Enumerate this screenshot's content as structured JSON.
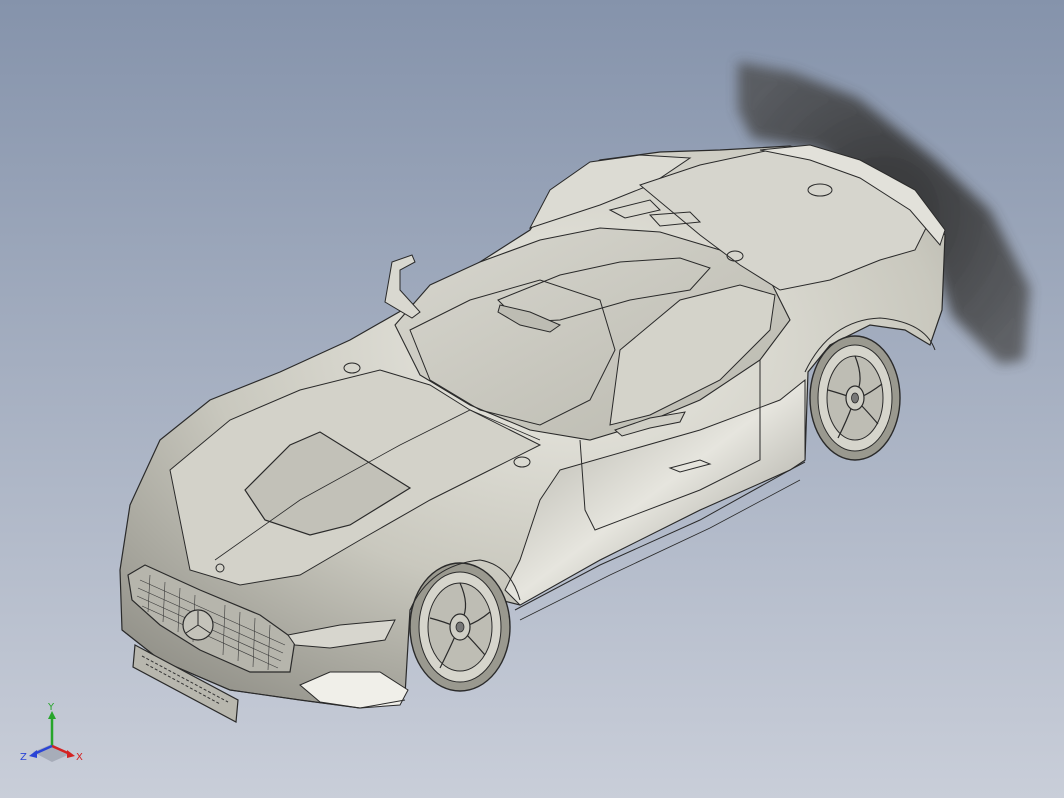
{
  "viewport": {
    "model": "car-body-3d",
    "background_top": "#8593ab",
    "background_bottom": "#c9ced9",
    "model_color": "#c8c7bd",
    "edge_color": "#2a2a2a"
  },
  "triad": {
    "x_label": "X",
    "y_label": "Y",
    "z_label": "Z",
    "x_color": "#d42222",
    "y_color": "#27a52b",
    "z_color": "#2a44d6"
  }
}
